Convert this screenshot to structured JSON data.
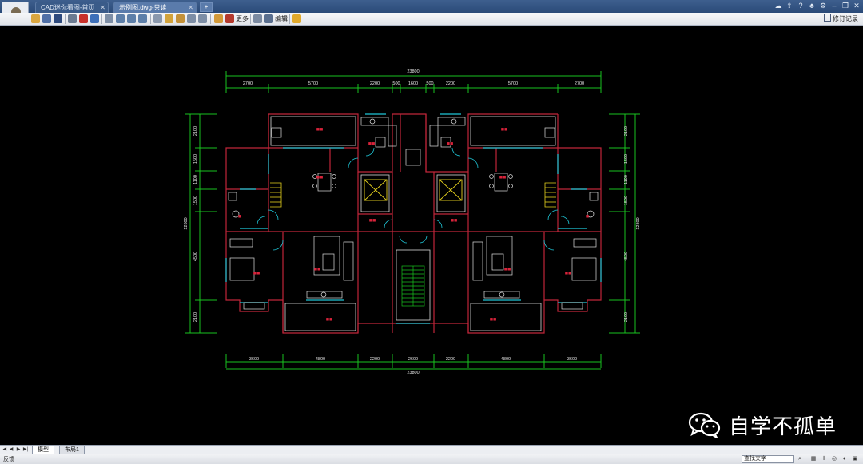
{
  "titlebar": {
    "tabs": [
      {
        "label": "CAD迷你看图-首页"
      },
      {
        "label": "示例图.dwg-只读"
      }
    ],
    "new_tab_glyph": "+",
    "icons": [
      "cloud-icon",
      "upload-icon",
      "help-icon",
      "skin-icon",
      "settings-icon",
      "minimize-icon",
      "restore-icon",
      "close-icon"
    ]
  },
  "toolbar": {
    "more_label": "更多",
    "edit_label": "编辑",
    "revision_label": "修订记录"
  },
  "drawing": {
    "top_total": "23800",
    "top_dims": [
      "2700",
      "5700",
      "2200",
      "500",
      "1600",
      "500",
      "2200",
      "5700",
      "2700"
    ],
    "bottom_dims": [
      "3600",
      "4800",
      "2200",
      "2600",
      "2200",
      "4800",
      "3600"
    ],
    "bottom_total": "23800",
    "left_dims": [
      "2100",
      "1500",
      "1100",
      "1500",
      "4500",
      "2100"
    ],
    "left_total": "12800",
    "right_dims": [
      "2100",
      "1500",
      "1100",
      "1500",
      "4500",
      "2100"
    ],
    "right_total": "12800"
  },
  "watermark": {
    "text": "自学不孤单"
  },
  "layout_tabs": {
    "nav": [
      "|◀",
      "◀",
      "▶",
      "▶|"
    ],
    "model_label": "模型",
    "layout_label": "布局1"
  },
  "statusbar": {
    "feedback_label": "反馈",
    "search_value": "查找文字"
  }
}
